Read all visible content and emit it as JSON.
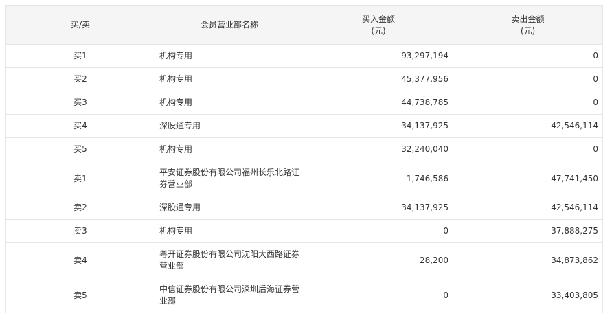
{
  "table": {
    "headers": {
      "side": "买/卖",
      "broker": "会员营业部名称",
      "buy_line1": "买入金额",
      "buy_line2": "(元)",
      "sell_line1": "卖出金额",
      "sell_line2": "(元)"
    },
    "rows": [
      {
        "side": "买1",
        "broker": "机构专用",
        "buy": "93,297,194",
        "sell": "0"
      },
      {
        "side": "买2",
        "broker": "机构专用",
        "buy": "45,377,956",
        "sell": "0"
      },
      {
        "side": "买3",
        "broker": "机构专用",
        "buy": "44,738,785",
        "sell": "0"
      },
      {
        "side": "买4",
        "broker": "深股通专用",
        "buy": "34,137,925",
        "sell": "42,546,114"
      },
      {
        "side": "买5",
        "broker": "机构专用",
        "buy": "32,240,040",
        "sell": "0"
      },
      {
        "side": "卖1",
        "broker": "平安证券股份有限公司福州长乐北路证券营业部",
        "buy": "1,746,586",
        "sell": "47,741,450"
      },
      {
        "side": "卖2",
        "broker": "深股通专用",
        "buy": "34,137,925",
        "sell": "42,546,114"
      },
      {
        "side": "卖3",
        "broker": "机构专用",
        "buy": "0",
        "sell": "37,888,275"
      },
      {
        "side": "卖4",
        "broker": "粤开证券股份有限公司沈阳大西路证券营业部",
        "buy": "28,200",
        "sell": "34,873,862"
      },
      {
        "side": "卖5",
        "broker": "中信证券股份有限公司深圳后海证券营业部",
        "buy": "0",
        "sell": "33,403,805"
      }
    ]
  }
}
